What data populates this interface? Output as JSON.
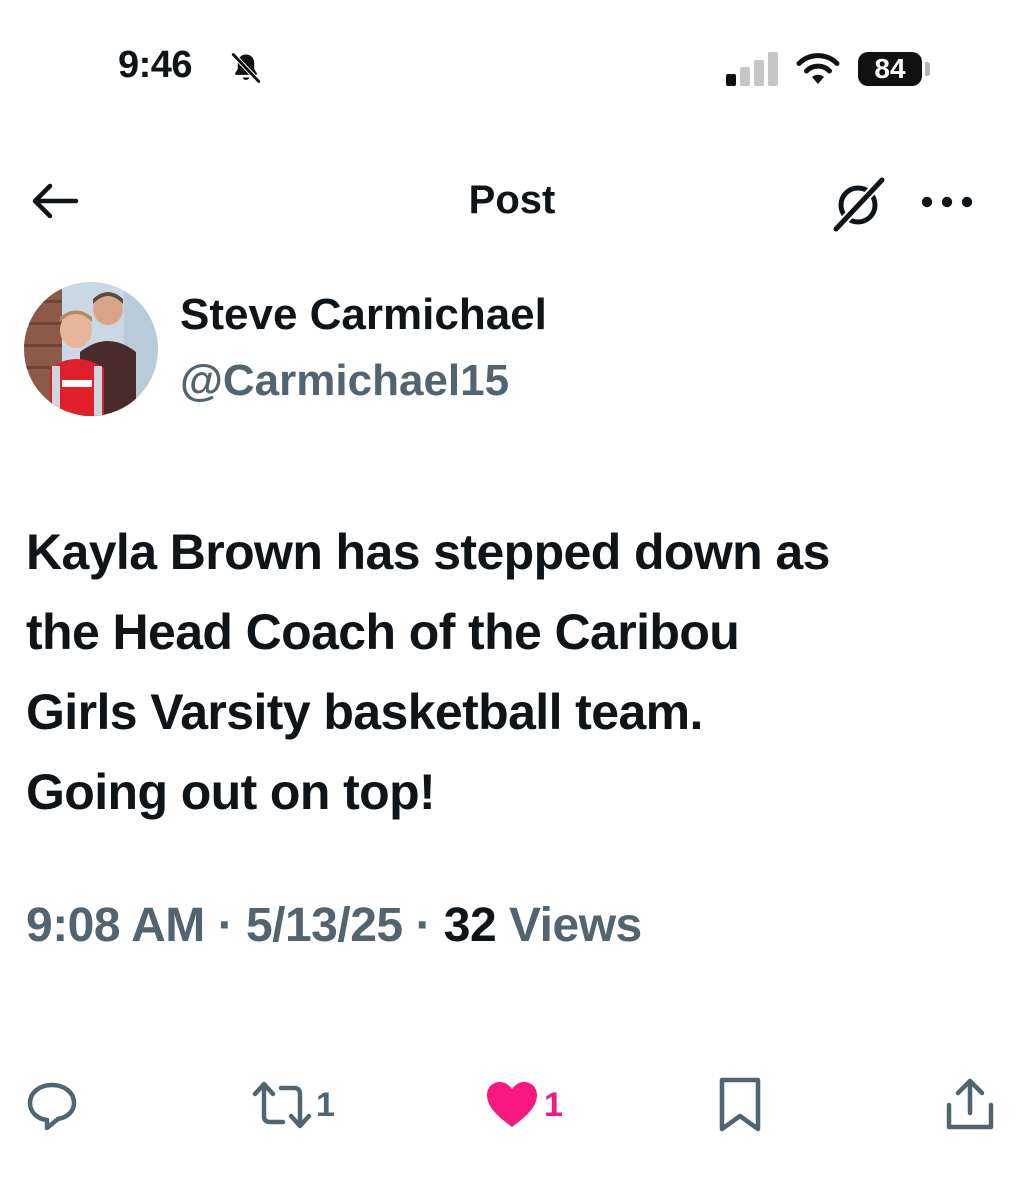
{
  "status_bar": {
    "time": "9:46",
    "battery_level": "84",
    "icons": [
      "bell-slash-icon",
      "cellular-signal-icon",
      "wifi-icon",
      "battery-icon"
    ]
  },
  "header": {
    "title": "Post",
    "icons": [
      "back-arrow-icon",
      "grok-icon",
      "more-icon"
    ]
  },
  "author": {
    "name": "Steve Carmichael",
    "handle": "@Carmichael15"
  },
  "post": {
    "text": "Kayla Brown has stepped down as\nthe Head Coach of the Caribou\nGirls Varsity basketball team.\nGoing out on top!",
    "time": "9:08 AM",
    "separator": "·",
    "date": "5/13/25",
    "views_count": "32",
    "views_label": "Views"
  },
  "actions": {
    "reply_count": "",
    "repost_count": "1",
    "like_count": "1",
    "liked": true,
    "icons": [
      "reply-icon",
      "repost-icon",
      "like-icon",
      "bookmark-icon",
      "share-icon"
    ]
  },
  "colors": {
    "text_primary": "#0f1419",
    "text_secondary": "#536471",
    "like": "#f91880"
  }
}
